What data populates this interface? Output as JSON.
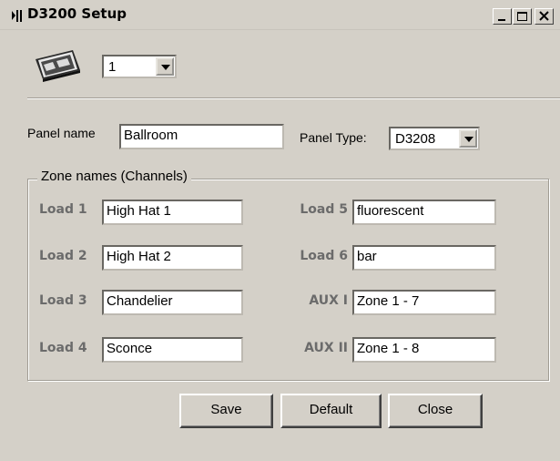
{
  "window": {
    "title": "D3200 Setup",
    "icons": {
      "app": "music-app-icon",
      "minimize": "minimize-icon",
      "maximize": "maximize-icon",
      "close": "close-icon"
    }
  },
  "device": {
    "icon": "dimmer-panel-icon",
    "unit_value": "1"
  },
  "panel": {
    "name_label": "Panel name",
    "name_value": "Ballroom",
    "type_label": "Panel Type:",
    "type_value": "D3208"
  },
  "zones": {
    "group_title": "Zone names (Channels)",
    "left": [
      {
        "label": "Load 1",
        "value": "High Hat 1"
      },
      {
        "label": "Load 2",
        "value": "High Hat 2"
      },
      {
        "label": "Load 3",
        "value": "Chandelier"
      },
      {
        "label": "Load 4",
        "value": "Sconce"
      }
    ],
    "right": [
      {
        "label": "Load 5",
        "value": "fluorescent"
      },
      {
        "label": "Load 6",
        "value": "bar"
      },
      {
        "label": "AUX I",
        "value": "Zone 1 - 7"
      },
      {
        "label": "AUX II",
        "value": "Zone 1 - 8"
      }
    ]
  },
  "buttons": {
    "save": "Save",
    "default": "Default",
    "close": "Close"
  },
  "colors": {
    "face": "#d4d0c8",
    "load_label": "#6b6b6b",
    "field": "#ffffff"
  }
}
